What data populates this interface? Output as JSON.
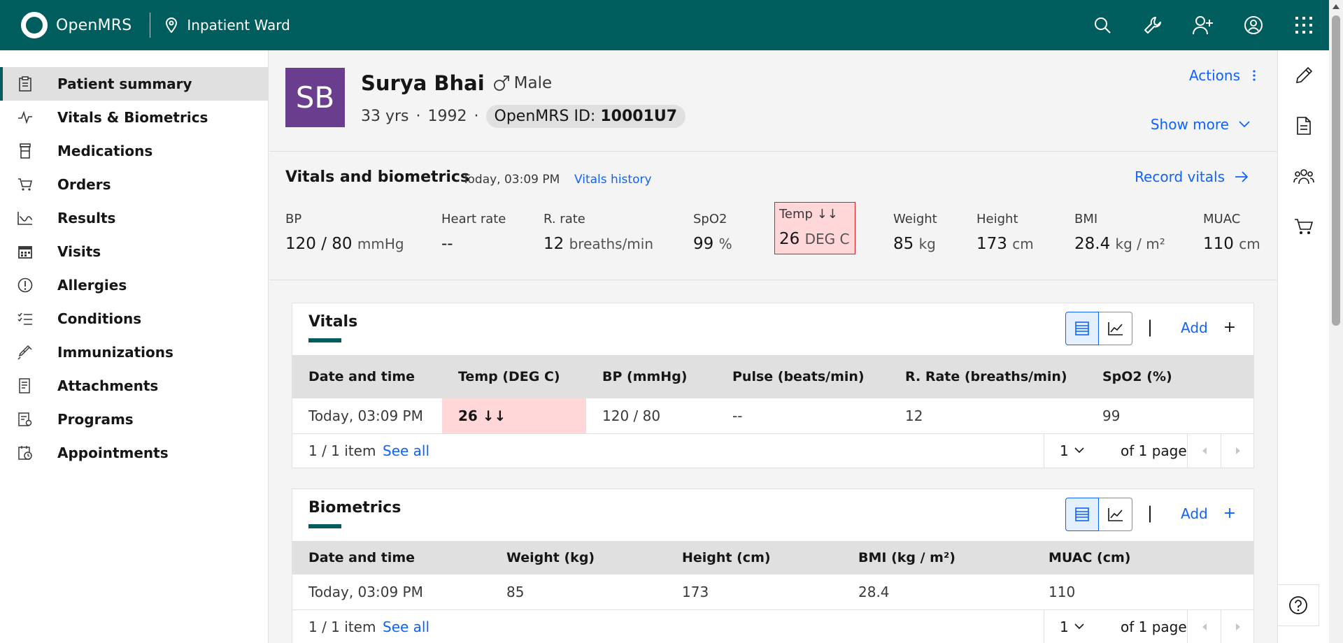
{
  "header": {
    "brand": "OpenMRS",
    "location": "Inpatient Ward",
    "icons": [
      "search-icon",
      "wrench-icon",
      "add-user-icon",
      "user-avatar-icon",
      "app-switcher-icon"
    ]
  },
  "sidebar": {
    "items": [
      {
        "label": "Patient summary",
        "icon": "clipboard-icon",
        "active": true
      },
      {
        "label": "Vitals & Biometrics",
        "icon": "activity-icon"
      },
      {
        "label": "Medications",
        "icon": "medication-icon"
      },
      {
        "label": "Orders",
        "icon": "cart-icon"
      },
      {
        "label": "Results",
        "icon": "chart-icon"
      },
      {
        "label": "Visits",
        "icon": "calendar-icon"
      },
      {
        "label": "Allergies",
        "icon": "warning-circle-icon"
      },
      {
        "label": "Conditions",
        "icon": "checklist-icon"
      },
      {
        "label": "Immunizations",
        "icon": "syringe-icon"
      },
      {
        "label": "Attachments",
        "icon": "attachment-icon"
      },
      {
        "label": "Programs",
        "icon": "program-icon"
      },
      {
        "label": "Appointments",
        "icon": "appointment-icon"
      }
    ]
  },
  "patient": {
    "initials": "SB",
    "name": "Surya Bhai",
    "gender": "Male",
    "age": "33 yrs",
    "birth_year": "1992",
    "id_label": "OpenMRS ID:",
    "id_value": "10001U7",
    "actions_label": "Actions",
    "show_more_label": "Show more"
  },
  "vitals_header": {
    "title": "Vitals and biometrics",
    "timestamp": "Today, 03:09 PM",
    "history_link": "Vitals history",
    "record_label": "Record vitals",
    "items": [
      {
        "label": "BP",
        "value": "120 / 80",
        "unit": "mmHg"
      },
      {
        "label": "Heart rate",
        "value": "--",
        "unit": ""
      },
      {
        "label": "R. rate",
        "value": "12",
        "unit": "breaths/min"
      },
      {
        "label": "SpO2",
        "value": "99",
        "unit": "%"
      },
      {
        "label": "Temp ↓↓",
        "value": "26",
        "unit": "DEG C",
        "abnormal": true
      },
      {
        "label": "Weight",
        "value": "85",
        "unit": "kg"
      },
      {
        "label": "Height",
        "value": "173",
        "unit": "cm"
      },
      {
        "label": "BMI",
        "value": "28.4",
        "unit": "kg / m²"
      },
      {
        "label": "MUAC",
        "value": "110",
        "unit": "cm"
      }
    ]
  },
  "vitals_card": {
    "title": "Vitals",
    "add_label": "Add",
    "separator": "|",
    "columns": [
      "Date and time",
      "Temp (DEG C)",
      "BP (mmHg)",
      "Pulse (beats/min)",
      "R. Rate (breaths/min)",
      "SpO2 (%)"
    ],
    "rows": [
      [
        "Today, 03:09 PM",
        "26 ↓↓",
        "120 / 80",
        "--",
        "12",
        "99"
      ]
    ],
    "item_count": "1 / 1 item",
    "see_all": "See all",
    "page": "1",
    "of_pages": "of 1 page"
  },
  "biometrics_card": {
    "title": "Biometrics",
    "add_label": "Add",
    "separator": "|",
    "columns": [
      "Date and time",
      "Weight (kg)",
      "Height (cm)",
      "BMI (kg / m²)",
      "MUAC (cm)"
    ],
    "rows": [
      [
        "Today, 03:09 PM",
        "85",
        "173",
        "28.4",
        "110"
      ]
    ],
    "item_count": "1 / 1 item",
    "see_all": "See all",
    "page": "1",
    "of_pages": "of 1 page"
  },
  "right_rail": {
    "icons": [
      "edit-icon",
      "document-icon",
      "group-icon",
      "cart-icon"
    ]
  },
  "help_icon": "help-icon"
}
